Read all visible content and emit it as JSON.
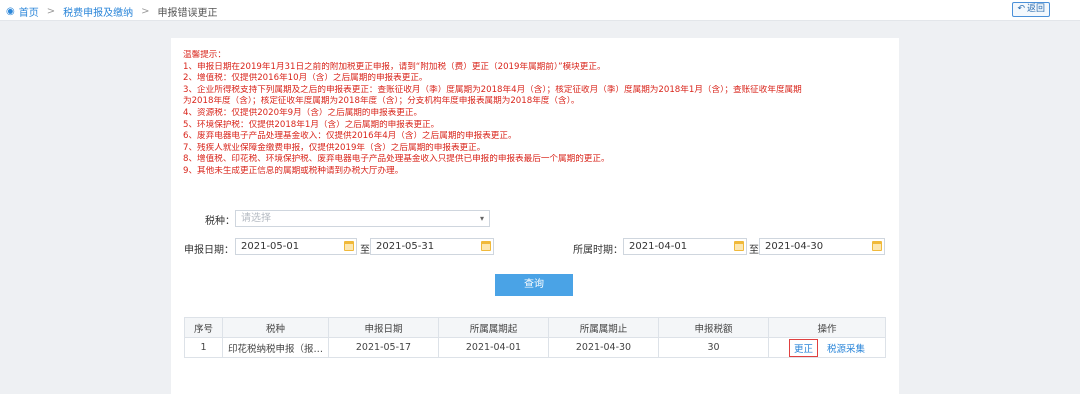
{
  "breadcrumb": {
    "home": "首页",
    "level1": "税费申报及缴纳",
    "current": "申报错误更正",
    "separator": ">"
  },
  "back_button": {
    "label": "返回"
  },
  "notice": {
    "lines": [
      "温馨提示：",
      "1、申报日期在2019年1月31日之前的附加税更正申报，请到“附加税（费）更正（2019年属期前）”模块更正。",
      "2、增值税：仅提供2016年10月（含）之后属期的申报表更正。",
      "3、企业所得税支持下列属期及之后的申报表更正：查账征收月（季）度属期为2018年4月（含）；核定征收月（季）度属期为2018年1月（含）；查账征收年度属期",
      "为2018年度（含）；核定征收年度属期为2018年度（含）；分支机构年度申报表属期为2018年度（含）。",
      "4、资源税：仅提供2020年9月（含）之后属期的申报表更正。",
      "5、环境保护税：仅提供2018年1月（含）之后属期的申报表更正。",
      "6、废弃电器电子产品处理基金收入：仅提供2016年4月（含）之后属期的申报表更正。",
      "7、残疾人就业保障金缴费申报，仅提供2019年（含）之后属期的申报表更正。",
      "8、增值税、印花税、环境保护税、废弃电器电子产品处理基金收入只提供已申报的申报表最后一个属期的更正。",
      "9、其他未生成更正信息的属期或税种请到办税大厅办理。"
    ]
  },
  "form": {
    "tax_label": "税种：",
    "tax_placeholder": "请选择",
    "declare_date_label": "申报日期：",
    "declare_from": "2021-05-01",
    "declare_to": "2021-05-31",
    "to_label": "至",
    "period_label": "所属时期：",
    "period_from": "2021-04-01",
    "period_to": "2021-04-30",
    "query_button": "查询"
  },
  "table": {
    "headers": [
      "序号",
      "税种",
      "申报日期",
      "所属属期起",
      "所属属期止",
      "申报税额",
      "操作"
    ],
    "rows": [
      {
        "index": "1",
        "tax": "印花税纳税申报（报…",
        "declare_date": "2021-05-17",
        "period_start": "2021-04-01",
        "period_end": "2021-04-30",
        "amount": "30",
        "action_edit": "更正",
        "action_collect": "税源采集"
      }
    ]
  },
  "colors": {
    "notice_red": "#d9261c",
    "link_blue": "#2b86d9",
    "query_button": "#4aa3e6",
    "highlight_box": "#e04040"
  }
}
